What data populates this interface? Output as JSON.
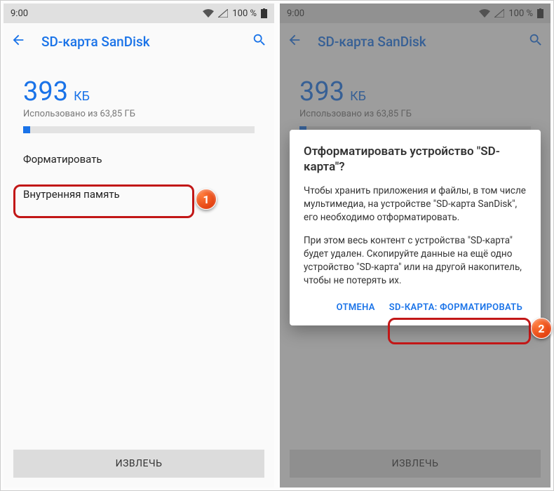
{
  "statusbar": {
    "time": "9:00",
    "battery": "100 %"
  },
  "appbar": {
    "title": "SD-карта SanDisk"
  },
  "storage": {
    "size_value": "393",
    "size_unit": "КБ",
    "used_label": "Использовано из 63,85 ГБ"
  },
  "options": {
    "format": "Форматировать",
    "internal": "Внутренняя память"
  },
  "eject_button": "ИЗВЛЕЧЬ",
  "dialog": {
    "title": "Отформатировать устройство \"SD-карта\"?",
    "p1": "Чтобы хранить приложения и файлы, в том числе мультимедиа, на устройстве \"SD-карта SanDisk\", его необходимо отформатировать.",
    "p2": "При этом весь контент с устройства \"SD-карта\" будет удален. Скопируйте данные на ещё одно устройство \"SD-карта\" или на другой накопитель, чтобы не потерять их.",
    "cancel": "ОТМЕНА",
    "confirm": "SD-КАРТА: ФОРМАТИРОВАТЬ"
  },
  "callouts": {
    "one": "1",
    "two": "2"
  }
}
